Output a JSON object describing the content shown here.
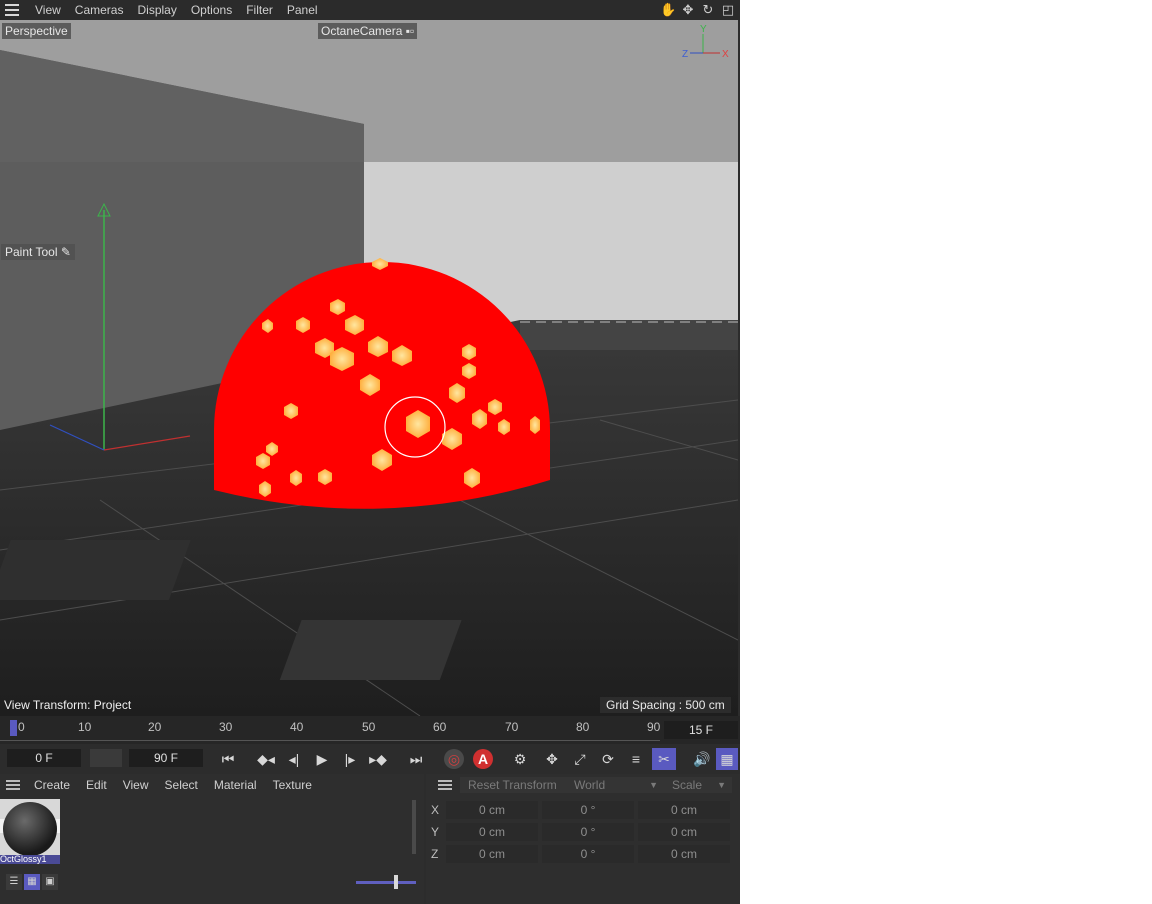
{
  "menubar": {
    "items": [
      "View",
      "Cameras",
      "Display",
      "Options",
      "Filter",
      "Panel"
    ],
    "nav_icons": [
      "hand-icon",
      "move-icon",
      "rotate-icon",
      "maximize-icon"
    ]
  },
  "viewport": {
    "projection": "Perspective",
    "camera": "OctaneCamera",
    "tool": "Paint Tool",
    "view_transform": "View Transform: Project",
    "grid_spacing": "Grid Spacing : 500 cm",
    "axis_labels": {
      "y": "Y",
      "z": "Z",
      "x": "X"
    },
    "colors": {
      "sphere": "#ff0000",
      "spots": "#ffd060",
      "floor": "#2a2a2a",
      "sky": "#cfcfcf",
      "wall": "#5c5c5c"
    }
  },
  "timeline": {
    "ticks": [
      "0",
      "10",
      "20",
      "30",
      "40",
      "50",
      "60",
      "70",
      "80",
      "90"
    ],
    "current_frame": "15 F"
  },
  "transport": {
    "start_frame": "0 F",
    "end_frame": "90 F",
    "autokey_label": "A"
  },
  "material_manager": {
    "menu": [
      "Create",
      "Edit",
      "View",
      "Select",
      "Material",
      "Texture"
    ],
    "material_name": "OctGlossy1"
  },
  "attributes": {
    "reset_label": "Reset Transform",
    "space": "World",
    "mode": "Scale",
    "rows": [
      {
        "axis": "X",
        "pos": "0 cm",
        "rot": "0 °",
        "scale": "0 cm"
      },
      {
        "axis": "Y",
        "pos": "0 cm",
        "rot": "0 °",
        "scale": "0 cm"
      },
      {
        "axis": "Z",
        "pos": "0 cm",
        "rot": "0 °",
        "scale": "0 cm"
      }
    ]
  }
}
